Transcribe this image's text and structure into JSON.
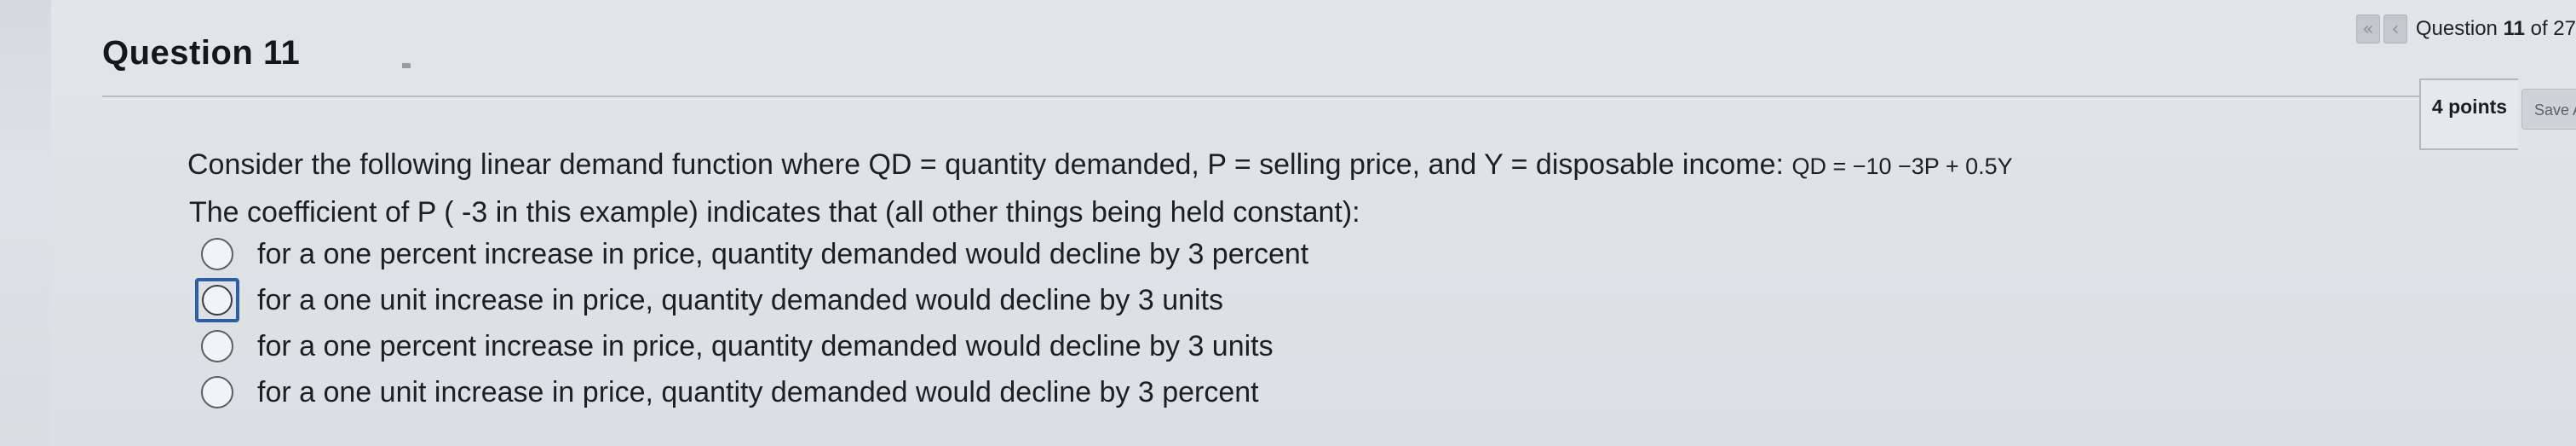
{
  "question": {
    "title": "Question 11",
    "points": "4 points"
  },
  "nav": {
    "prefix": "Question ",
    "current": "11",
    "suffix": " of 27",
    "first_icon": "double-chevron-left-icon",
    "prev_icon": "chevron-left-icon"
  },
  "toolbar": {
    "save_label": "Save A"
  },
  "prompt": {
    "line1_text": "Consider the following linear demand function where QD = quantity demanded, P = selling price, and Y = disposable income: ",
    "line1_equation": "QD = −10 −3P + 0.5Y",
    "line2": "The coefficient of P ( -3 in this example) indicates that (all other things being held constant):"
  },
  "options": [
    {
      "label": "for a one percent increase in price, quantity demanded would decline by 3 percent",
      "selected": false,
      "focused": false
    },
    {
      "label": "for a one unit increase in price, quantity demanded would decline by 3 units",
      "selected": false,
      "focused": true
    },
    {
      "label": "for a one percent increase in price, quantity demanded would decline by 3 units",
      "selected": false,
      "focused": false
    },
    {
      "label": "for a one unit increase in price, quantity demanded would decline by 3 percent",
      "selected": false,
      "focused": false
    }
  ],
  "colors": {
    "focus_ring": "#2a5ea5",
    "background": "#dcdfe3"
  }
}
